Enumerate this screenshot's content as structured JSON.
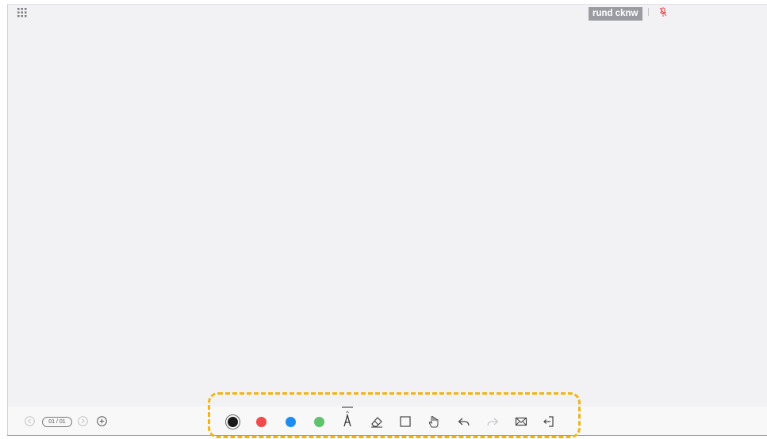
{
  "header": {
    "user_name": "rund cknw",
    "icons": [
      "apps-grid-icon",
      "mic-muted-icon"
    ]
  },
  "pager": {
    "indicator": "01 / 01",
    "icons": [
      "prev-page-icon",
      "next-page-icon",
      "add-page-icon"
    ]
  },
  "toolbar": {
    "colors": [
      {
        "name": "black",
        "hex": "#1a1a1a"
      },
      {
        "name": "red",
        "hex": "#f04a4a"
      },
      {
        "name": "blue",
        "hex": "#1d8ef0"
      },
      {
        "name": "green",
        "hex": "#5fc26c"
      }
    ],
    "tools": [
      "pen-icon",
      "eraser-icon",
      "rectangle-icon",
      "hand-pan-icon",
      "undo-icon",
      "redo-icon",
      "email-icon",
      "exit-icon"
    ]
  },
  "highlight_color": "#f0b415",
  "canvas_color": "#f2f2f4"
}
